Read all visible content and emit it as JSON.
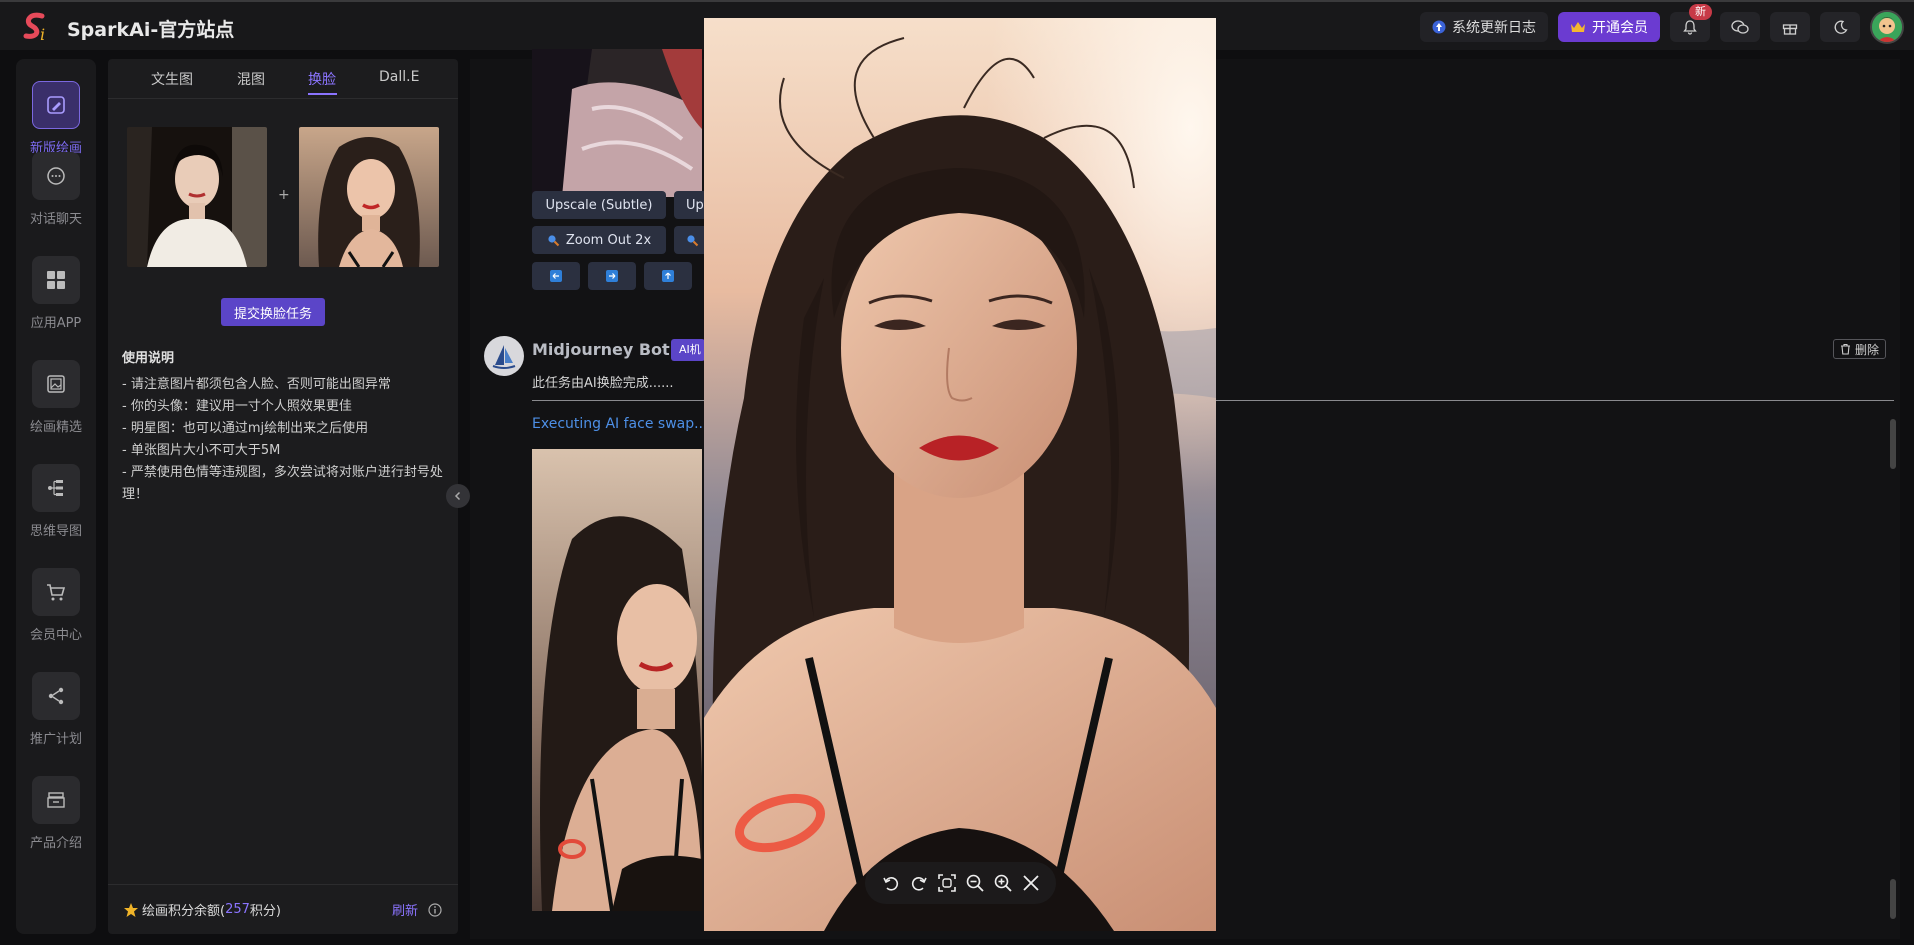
{
  "app": {
    "title": "SparkAi-官方站点"
  },
  "topbar": {
    "changelog": "系统更新日志",
    "vip": "开通会员",
    "badge": "新"
  },
  "nav": [
    {
      "label": "新版绘画",
      "icon": "paint-icon",
      "active": true
    },
    {
      "label": "对话聊天",
      "icon": "chat-icon"
    },
    {
      "label": "应用APP",
      "icon": "apps-icon"
    },
    {
      "label": "绘画精选",
      "icon": "gallery-icon"
    },
    {
      "label": "思维导图",
      "icon": "mindmap-icon"
    },
    {
      "label": "会员中心",
      "icon": "cart-icon"
    },
    {
      "label": "推广计划",
      "icon": "share-icon"
    },
    {
      "label": "产品介绍",
      "icon": "product-icon"
    }
  ],
  "panel": {
    "tabs": [
      "文生图",
      "混图",
      "换脸",
      "Dall.E"
    ],
    "active_tab": 2,
    "plus": "+",
    "submit": "提交换脸任务",
    "usage_title": "使用说明",
    "usage_items": [
      "- 请注意图片都须包含人脸、否则可能出图异常",
      "- 你的头像：建议用一寸个人照效果更佳",
      "- 明星图：也可以通过mj绘制出来之后使用",
      "- 单张图片大小不可大于5M",
      "- 严禁使用色情等违规图，多次尝试将对账户进行封号处理！"
    ],
    "balance_prefix": "绘画积分余额(",
    "balance_value": "257",
    "balance_suffix": "积分)",
    "refresh": "刷新"
  },
  "main": {
    "buttons_row1": [
      "Upscale (Subtle)",
      "Up"
    ],
    "buttons_row2": [
      "Zoom Out 2x",
      ""
    ],
    "bot_name": "Midjourney Bot",
    "bot_tag": "AI机",
    "message": "此任务由AI换脸完成......",
    "executing": "Executing AI face swap...",
    "delete": "删除"
  },
  "colors": {
    "accent": "#8b74ff",
    "vip": "#6b3bd1",
    "link": "#4d8fe6"
  }
}
